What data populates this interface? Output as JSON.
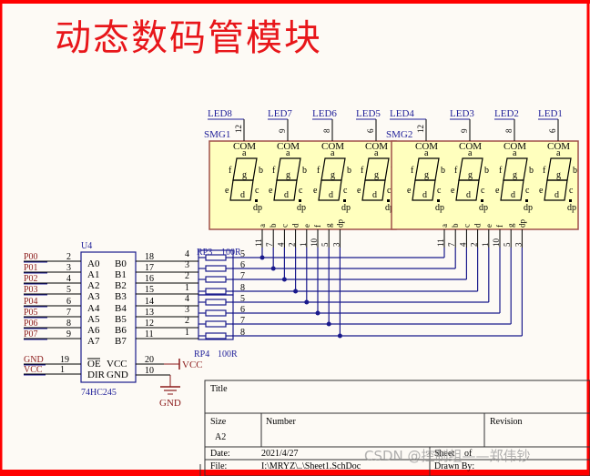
{
  "page_title": "动态数码管模块",
  "colors": {
    "border_red": "#ff0000",
    "wire_blue": "#1a1a8c",
    "label_blue": "#1f1f99",
    "net_red": "#8b1a1a",
    "display_fill": "#ffffbe",
    "display_border": "#a0504a",
    "title_red": "#e8161a"
  },
  "displays": [
    {
      "ref": "SMG1",
      "com_pin": "12",
      "digits": [
        {
          "net": "LED8",
          "pin": "12"
        },
        {
          "net": "LED7",
          "pin": "9"
        },
        {
          "net": "LED6",
          "pin": "8"
        },
        {
          "net": "LED5",
          "pin": "6"
        }
      ],
      "segment_labels": [
        "a",
        "b",
        "c",
        "d",
        "e",
        "f",
        "g",
        "dp"
      ],
      "segment_pins": [
        "11",
        "7",
        "4",
        "2",
        "1",
        "10",
        "5",
        "3"
      ]
    },
    {
      "ref": "SMG2",
      "com_pin": "12",
      "digits": [
        {
          "net": "LED4",
          "pin": "12"
        },
        {
          "net": "LED3",
          "pin": "9"
        },
        {
          "net": "LED2",
          "pin": "8"
        },
        {
          "net": "LED1",
          "pin": "6"
        }
      ],
      "segment_labels": [
        "a",
        "b",
        "c",
        "d",
        "e",
        "f",
        "g",
        "dp"
      ],
      "segment_pins": [
        "11",
        "7",
        "4",
        "2",
        "1",
        "10",
        "5",
        "3"
      ]
    }
  ],
  "digit_labels": {
    "com": "COM",
    "a": "a",
    "b": "b",
    "c": "c",
    "d": "d",
    "e": "e",
    "f": "f",
    "g": "g",
    "dp": "dp"
  },
  "buffer": {
    "ref": "U4",
    "part": "74HC245",
    "inputs": [
      {
        "net": "P00",
        "pin": "2",
        "name": "A0"
      },
      {
        "net": "P01",
        "pin": "3",
        "name": "A1"
      },
      {
        "net": "P02",
        "pin": "4",
        "name": "A2"
      },
      {
        "net": "P03",
        "pin": "5",
        "name": "A3"
      },
      {
        "net": "P04",
        "pin": "6",
        "name": "A4"
      },
      {
        "net": "P05",
        "pin": "7",
        "name": "A5"
      },
      {
        "net": "P06",
        "pin": "8",
        "name": "A6"
      },
      {
        "net": "P07",
        "pin": "9",
        "name": "A7"
      }
    ],
    "outputs": [
      {
        "name": "B0",
        "pin": "18"
      },
      {
        "name": "B1",
        "pin": "17"
      },
      {
        "name": "B2",
        "pin": "16"
      },
      {
        "name": "B3",
        "pin": "15"
      },
      {
        "name": "B4",
        "pin": "14"
      },
      {
        "name": "B5",
        "pin": "13"
      },
      {
        "name": "B6",
        "pin": "12"
      },
      {
        "name": "B7",
        "pin": "11"
      }
    ],
    "control": [
      {
        "net": "GND",
        "pin": "19",
        "name": "OE"
      },
      {
        "net": "VCC",
        "pin": "1",
        "name": "DIR"
      }
    ],
    "power": [
      {
        "name": "VCC",
        "pin": "20",
        "net": "VCC"
      },
      {
        "name": "GND",
        "pin": "10",
        "net": "GND"
      }
    ]
  },
  "resistor_packs": [
    {
      "ref": "RP3",
      "value": "100R",
      "left_pins": [
        "4",
        "3",
        "2",
        "1"
      ],
      "right_pins": [
        "5",
        "6",
        "7",
        "8"
      ]
    },
    {
      "ref": "RP4",
      "value": "100R",
      "left_pins": [
        "4",
        "3",
        "2",
        "1"
      ],
      "right_pins": [
        "5",
        "6",
        "7",
        "8"
      ]
    }
  ],
  "title_block": {
    "title_label": "Title",
    "size_label": "Size",
    "size_value": "A2",
    "number_label": "Number",
    "revision_label": "Revision",
    "date_label": "Date:",
    "date_value": "2021/4/27",
    "file_label": "File:",
    "file_value": "I:\\MRYZ\\..\\Sheet1.SchDoc",
    "sheet_label": "Sheet",
    "sheet_value": "of",
    "drawn_label": "Drawn By:"
  },
  "watermark": "CSDN @控制组——郑伟钞"
}
